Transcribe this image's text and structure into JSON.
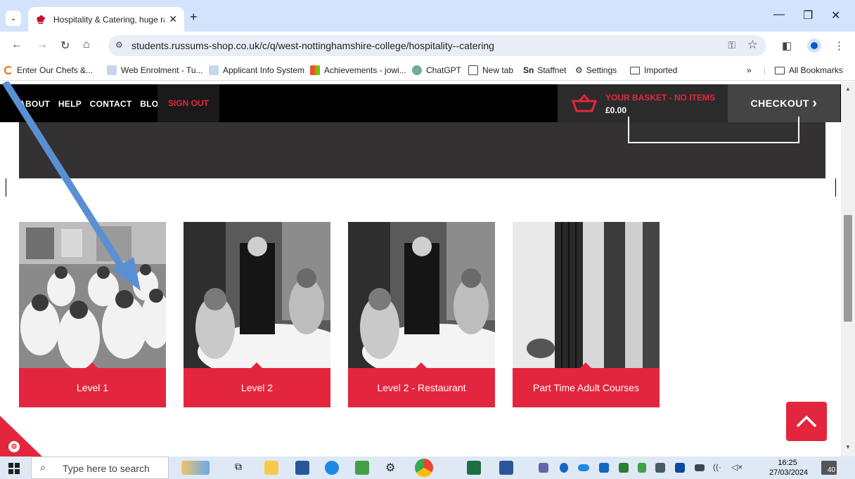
{
  "browser": {
    "tab_title": "Hospitality & Catering, huge ra",
    "tab_close": "✕",
    "new_tab": "+",
    "tab_menu": "⌄",
    "url": "students.russums-shop.co.uk/c/q/west-nottinghamshire-college/hospitality--catering",
    "bookmarks": [
      {
        "label": "Enter Our Chefs &...",
        "icon": "orange-c-icon",
        "color": "#e8710a"
      },
      {
        "label": "Web Enrolment - Tu...",
        "icon": "doc-icon",
        "color": "#9fb7d9"
      },
      {
        "label": "Applicant Info System",
        "icon": "doc-icon",
        "color": "#9fb7d9"
      },
      {
        "label": "Achievements - jowi...",
        "icon": "microsoft-icon",
        "color": "#f25022"
      },
      {
        "label": "ChatGPT",
        "icon": "chatgpt-icon",
        "color": "#74aa9c"
      },
      {
        "label": "New tab",
        "icon": "newtab-icon",
        "color": "#444444"
      },
      {
        "label": "Staffnet",
        "icon": "sn-icon",
        "color": "#222222"
      },
      {
        "label": "Settings",
        "icon": "gear-icon",
        "color": "#444444"
      },
      {
        "label": "Imported",
        "icon": "folder-icon",
        "color": "#444444"
      }
    ],
    "bookmarks_more": "»",
    "all_bookmarks": "All Bookmarks"
  },
  "site": {
    "nav_links": [
      "ABOUT",
      "HELP",
      "CONTACT",
      "BLOG"
    ],
    "sign_out": "SIGN OUT",
    "basket_label": "YOUR BASKET - NO ITEMS",
    "basket_price": "£0.00",
    "checkout": "CHECKOUT",
    "checkout_chevron": "›",
    "accent": "#e3263e",
    "categories": [
      {
        "label": "Level 1"
      },
      {
        "label": "Level 2"
      },
      {
        "label": "Level 2 - Restaurant"
      },
      {
        "label": "Part Time Adult Courses"
      }
    ]
  },
  "taskbar": {
    "search_placeholder": "Type here to search",
    "time": "16:25",
    "date": "27/03/2024",
    "notifications": "40"
  }
}
